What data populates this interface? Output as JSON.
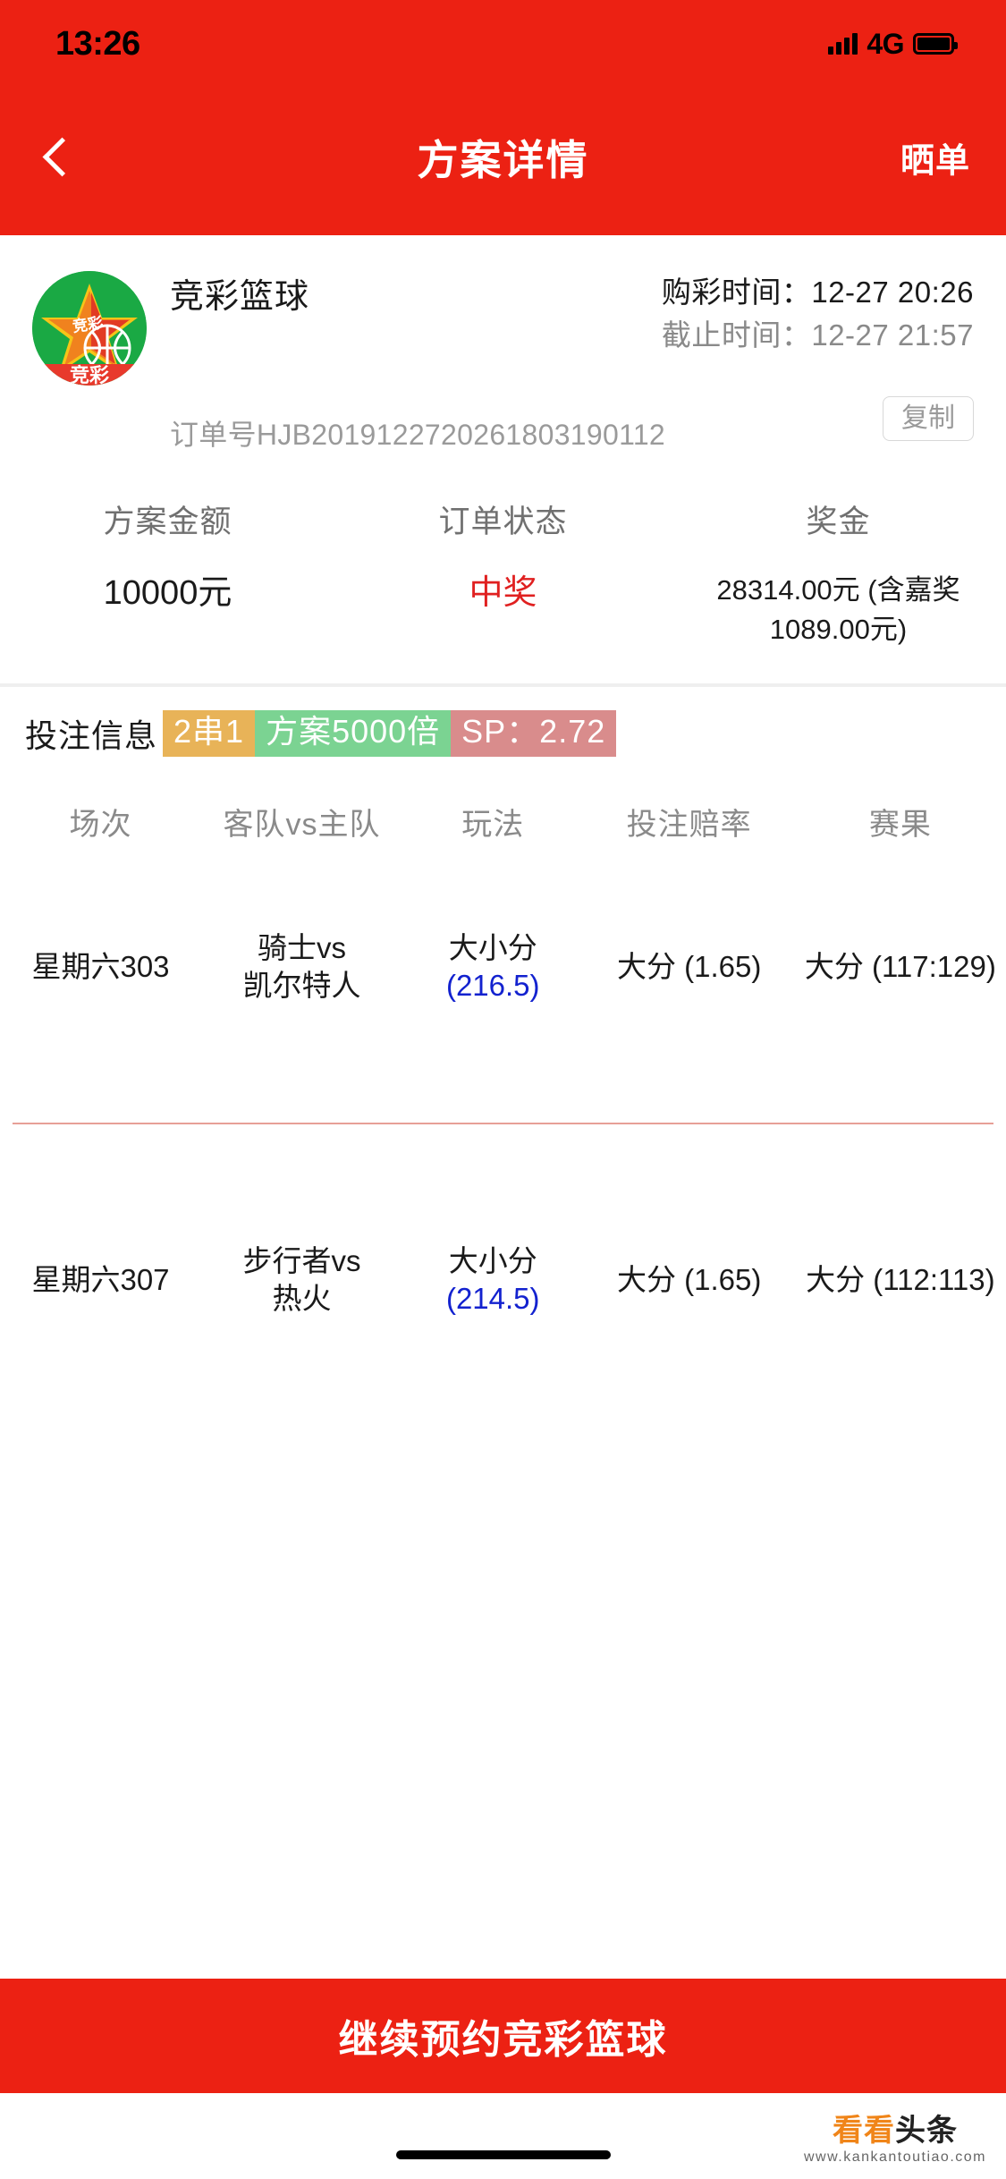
{
  "status_bar": {
    "time": "13:26",
    "network": "4G",
    "signal_icon": "signal-bars-icon",
    "battery_icon": "battery-full-icon"
  },
  "nav": {
    "back_icon": "chevron-left-icon",
    "title": "方案详情",
    "action_label": "晒单"
  },
  "order": {
    "logo_icon": "jingcai-basketball-logo-icon",
    "logo_star_text": "竞彩",
    "logo_banner_text": "竞彩",
    "lottery_name": "竞彩篮球",
    "purchase_time_label": "购彩时间：",
    "purchase_time_value": "12-27 20:26",
    "deadline_label": "截止时间：",
    "deadline_value": "12-27 21:57",
    "order_no_label": "订单号",
    "order_no_value": "HJB2019122720261803190112",
    "copy_label": "复制"
  },
  "stats": [
    {
      "label": "方案金额",
      "value": "10000元",
      "style": "normal"
    },
    {
      "label": "订单状态",
      "value": "中奖",
      "style": "red"
    },
    {
      "label": "奖金",
      "value": "28314.00元 (含嘉奖 1089.00元)",
      "style": "small"
    }
  ],
  "bet_info": {
    "label": "投注信息",
    "tags": [
      {
        "text": "2串1",
        "color": "#e8b358"
      },
      {
        "text": "方案5000倍",
        "color": "#7bd392"
      },
      {
        "text": "SP：2.72",
        "color": "#d98c8c"
      }
    ]
  },
  "table": {
    "headers": [
      "场次",
      "客队vs主队",
      "玩法",
      "投注赔率",
      "赛果"
    ],
    "rows": [
      {
        "match_no": "星期六303",
        "away": "骑士vs",
        "home": "凯尔特人",
        "play": "大小分",
        "play_line": "(216.5)",
        "odds": "大分 (1.65)",
        "result": "大分 (117:129)"
      },
      {
        "match_no": "星期六307",
        "away": "步行者vs",
        "home": "热火",
        "play": "大小分",
        "play_line": "(214.5)",
        "odds": "大分 (1.65)",
        "result": "大分 (112:113)"
      }
    ]
  },
  "cta": {
    "label": "继续预约竞彩篮球"
  },
  "watermark": {
    "brand_part1": "看看",
    "brand_part2": "头条",
    "url": "www.kankantoutiao.com"
  },
  "colors": {
    "brand_red": "#ec2113",
    "status_red": "#e02020",
    "link_blue": "#1322cf",
    "result_red": "#d93a24"
  }
}
